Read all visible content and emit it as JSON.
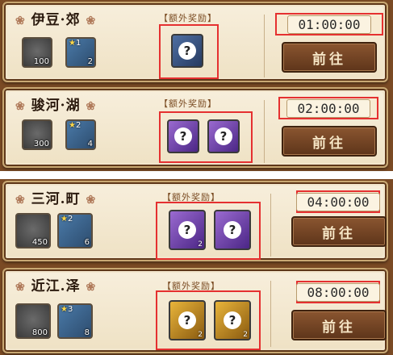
{
  "colors": {
    "highlight": "#e53030",
    "panel": "#7a4a24",
    "card": "#f2e6cd"
  },
  "rows": [
    {
      "name": "伊豆·郊",
      "extra_label": "【额外奖励】",
      "timer": "01:00:00",
      "go_label": "前往",
      "coin_qty": "100",
      "painting_stars": "1",
      "painting_level": "",
      "painting_qty": "2",
      "reward_cards": [
        {
          "color": "blue",
          "glyph": "?",
          "count": ""
        }
      ]
    },
    {
      "name": "骏河·湖",
      "extra_label": "【额外奖励】",
      "timer": "02:00:00",
      "go_label": "前往",
      "coin_qty": "300",
      "painting_stars": "2",
      "painting_level": "",
      "painting_qty": "4",
      "reward_cards": [
        {
          "color": "purple",
          "glyph": "?",
          "count": ""
        },
        {
          "color": "purple",
          "glyph": "?",
          "count": ""
        }
      ]
    },
    {
      "name": "三河.町",
      "extra_label": "【额外奖励】",
      "timer": "04:00:00",
      "go_label": "前往",
      "coin_qty": "450",
      "painting_stars": "2",
      "painting_level": "",
      "painting_qty": "6",
      "reward_cards": [
        {
          "color": "purple",
          "glyph": "?",
          "count": "2"
        },
        {
          "color": "purple",
          "glyph": "?",
          "count": ""
        }
      ]
    },
    {
      "name": "近江.泽",
      "extra_label": "【额外奖励】",
      "timer": "08:00:00",
      "go_label": "前往",
      "coin_qty": "800",
      "painting_stars": "3",
      "painting_level": "",
      "painting_qty": "8",
      "reward_cards": [
        {
          "color": "gold",
          "glyph": "?",
          "count": "2"
        },
        {
          "color": "gold",
          "glyph": "?",
          "count": "2"
        }
      ]
    }
  ]
}
